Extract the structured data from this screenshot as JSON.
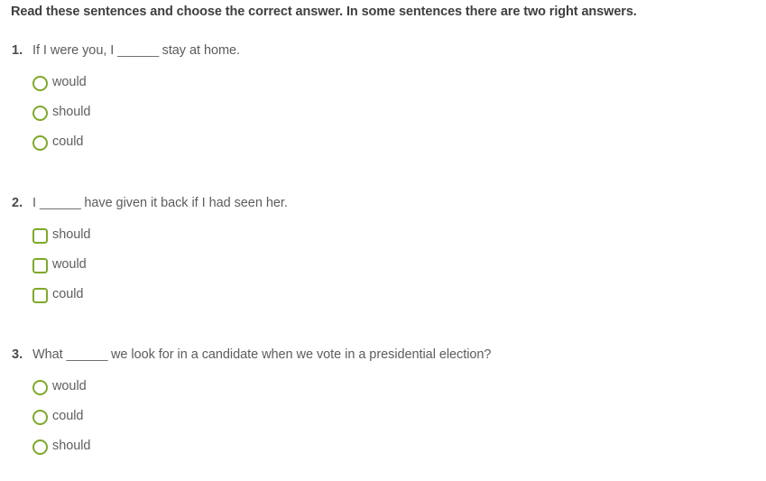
{
  "instruction": "Read these sentences and choose the correct answer. In some sentences there are two right answers.",
  "theme": {
    "accent_green": "#7fa82b",
    "text_gray": "#5c5c5c",
    "heading_gray": "#3f3f3f",
    "background": "#ffffff"
  },
  "questions": [
    {
      "number": "1.",
      "text_before": "If I were you, I ",
      "blank": "______",
      "text_after": " stay at home.",
      "control_type": "radio",
      "options": [
        {
          "label": "would",
          "checked": false
        },
        {
          "label": "should",
          "checked": false
        },
        {
          "label": "could",
          "checked": false
        }
      ]
    },
    {
      "number": "2.",
      "text_before": "I ",
      "blank": "______",
      "text_after": " have given it back if I had seen her.",
      "control_type": "checkbox",
      "options": [
        {
          "label": "should",
          "checked": false
        },
        {
          "label": "would",
          "checked": false
        },
        {
          "label": "could",
          "checked": false
        }
      ]
    },
    {
      "number": "3.",
      "text_before": "What ",
      "blank": "______",
      "text_after": " we look for in a candidate when we vote in a presidential election?",
      "control_type": "radio",
      "options": [
        {
          "label": "would",
          "checked": false
        },
        {
          "label": "could",
          "checked": false
        },
        {
          "label": "should",
          "checked": false
        }
      ]
    }
  ]
}
